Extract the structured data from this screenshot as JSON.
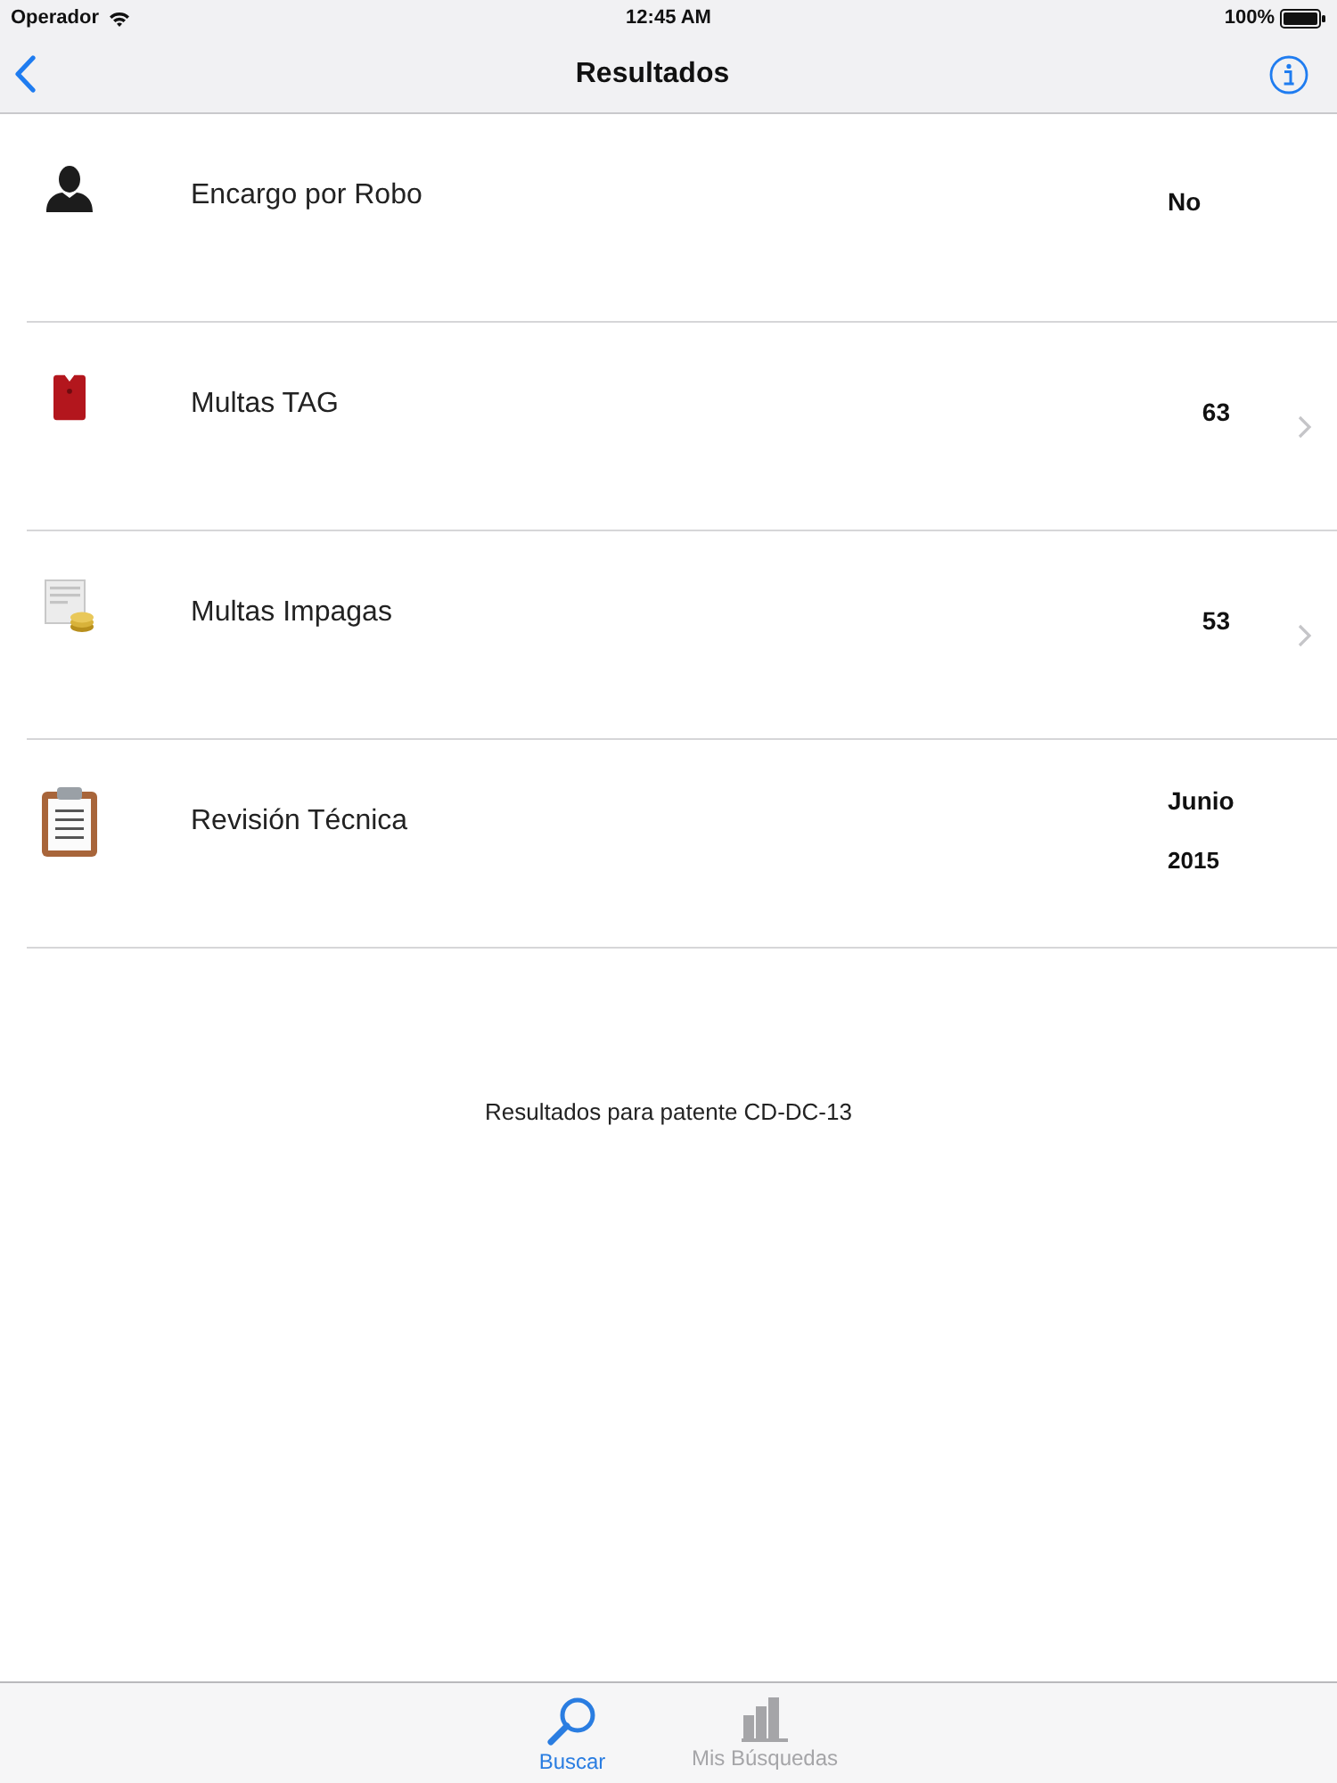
{
  "status_bar": {
    "carrier": "Operador",
    "time": "12:45 AM",
    "battery": "100%"
  },
  "nav_bar": {
    "title": "Resultados"
  },
  "results": [
    {
      "kind": "person",
      "label": "Encargo por Robo",
      "values": [
        "No"
      ],
      "disclosure": false
    },
    {
      "kind": "tag",
      "label": "Multas TAG",
      "values": [
        "63"
      ],
      "disclosure": true
    },
    {
      "kind": "coins",
      "label": "Multas Impagas",
      "values": [
        "53"
      ],
      "disclosure": true
    },
    {
      "kind": "clipboard",
      "label": "Revisión Técnica",
      "values": [
        "Junio",
        "2015"
      ],
      "disclosure": false
    }
  ],
  "footer_note": "Resultados para patente CD-DC-13",
  "tab_bar": {
    "tabs": [
      {
        "kind": "search",
        "label": "Buscar",
        "selected": true
      },
      {
        "kind": "chart",
        "label": "Mis Búsquedas",
        "selected": false
      }
    ]
  }
}
